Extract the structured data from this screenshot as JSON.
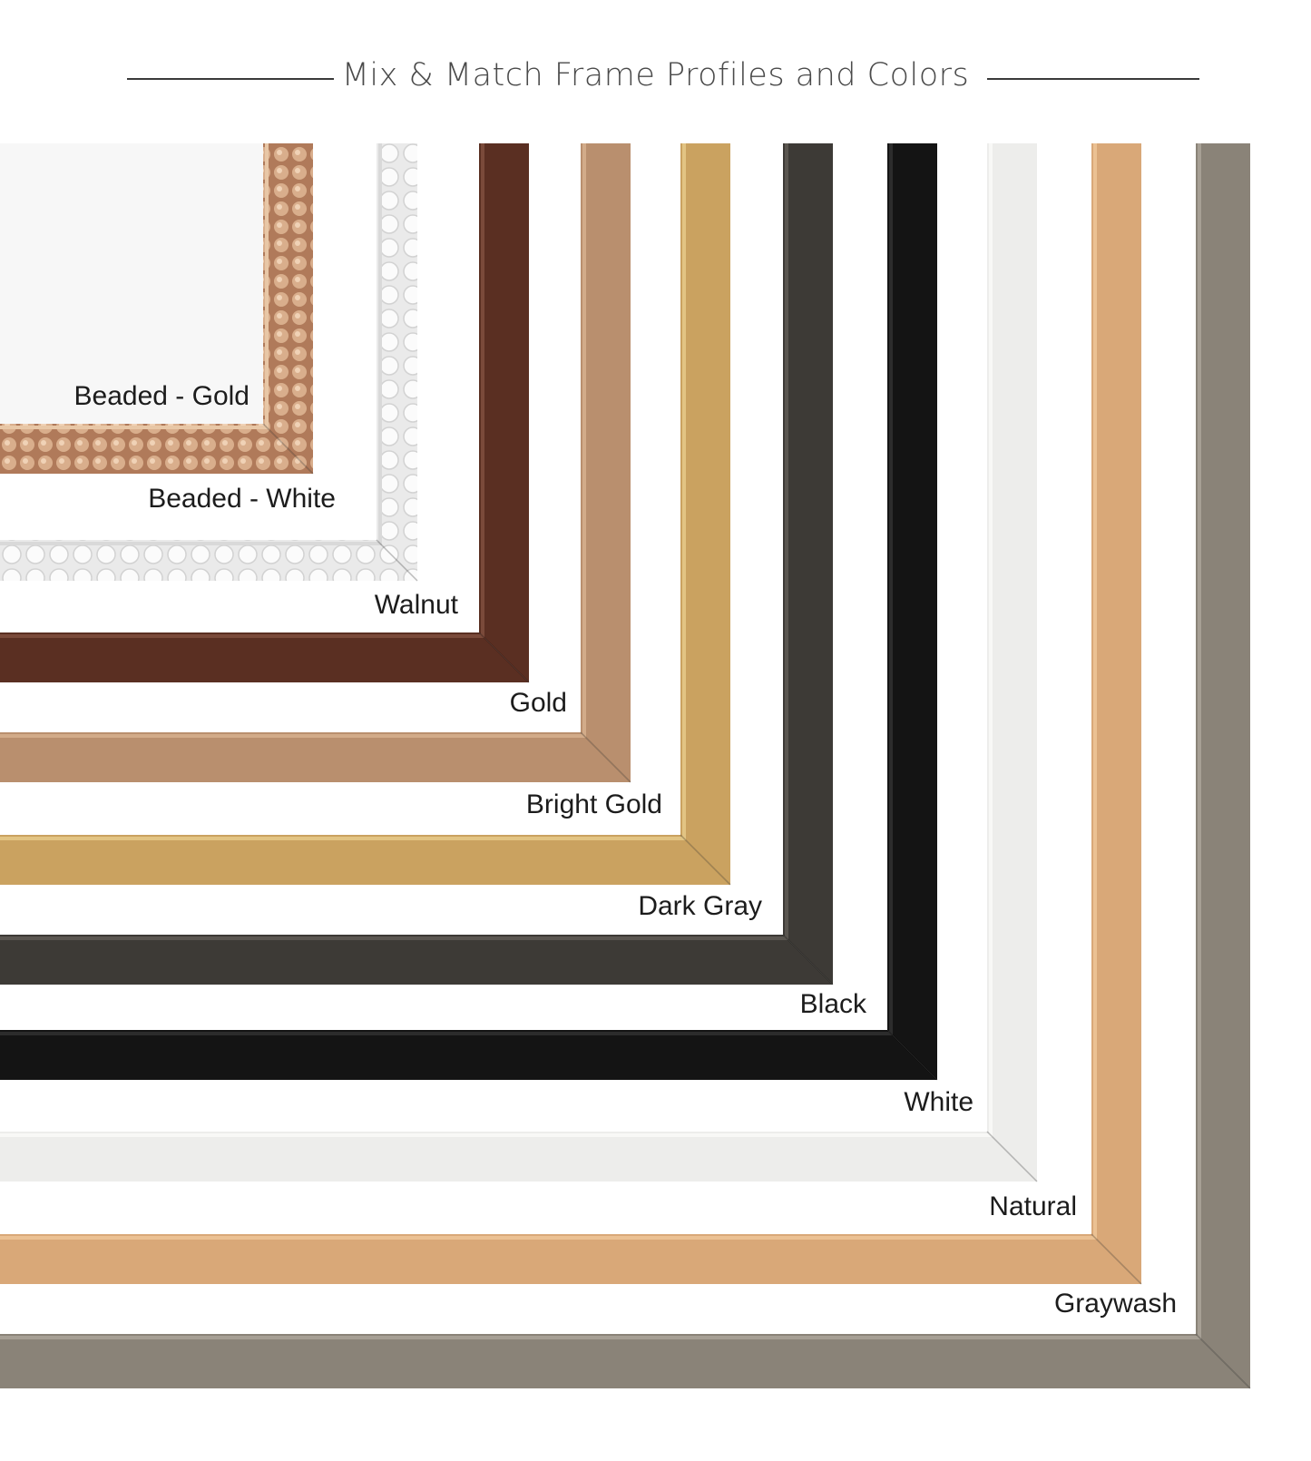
{
  "header": {
    "title": "Mix & Match Frame Profiles and Colors"
  },
  "frames": [
    {
      "label": "Beaded - Gold",
      "color": "#c99a78",
      "accent": "#e8c7a6",
      "profile": "beaded"
    },
    {
      "label": "Beaded - White",
      "color": "#f2f2f2",
      "accent": "#d9d9d9",
      "profile": "beaded"
    },
    {
      "label": "Walnut",
      "color": "#5a2f22",
      "accent": "#7a4a3a",
      "profile": "flat"
    },
    {
      "label": "Gold",
      "color": "#b98f6e",
      "accent": "#d2ab89",
      "profile": "flat"
    },
    {
      "label": "Bright Gold",
      "color": "#caa260",
      "accent": "#e2c483",
      "profile": "flat"
    },
    {
      "label": "Dark Gray",
      "color": "#3d3a36",
      "accent": "#5a5650",
      "profile": "flat"
    },
    {
      "label": "Black",
      "color": "#141414",
      "accent": "#2c2c2c",
      "profile": "flat"
    },
    {
      "label": "White",
      "color": "#ededeb",
      "accent": "#f8f8f6",
      "profile": "flat"
    },
    {
      "label": "Natural",
      "color": "#d9a878",
      "accent": "#ebc193",
      "profile": "flat"
    },
    {
      "label": "Graywash",
      "color": "#8a8378",
      "accent": "#a69f94",
      "profile": "flat"
    }
  ]
}
